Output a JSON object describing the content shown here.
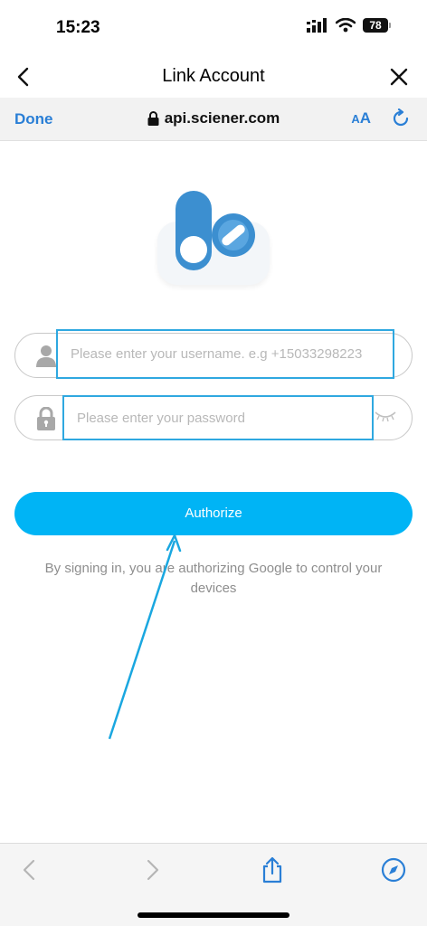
{
  "status_bar": {
    "time": "15:23",
    "battery": "78"
  },
  "header": {
    "title": "Link Account"
  },
  "browser": {
    "done_label": "Done",
    "url": "api.sciener.com",
    "text_size_label_small": "A",
    "text_size_label_big": "A"
  },
  "form": {
    "username_placeholder": "Please enter your username. e.g +15033298223",
    "password_placeholder": "Please enter your password",
    "authorize_label": "Authorize",
    "consent_text": "By signing in, you are authorizing Google to control your devices"
  },
  "colors": {
    "accent": "#00b4f5",
    "link": "#2a7fd6",
    "annotation": "#1aa7e0",
    "logo_blue": "#3c8fd0"
  },
  "icons": {
    "back": "chevron-left-icon",
    "close": "close-icon",
    "lock": "lock-icon",
    "reload": "reload-icon",
    "user": "user-icon",
    "password": "lock-icon",
    "eye": "eye-closed-icon",
    "nav_back": "chevron-left-icon",
    "nav_forward": "chevron-right-icon",
    "share": "share-icon",
    "compass": "compass-icon"
  }
}
